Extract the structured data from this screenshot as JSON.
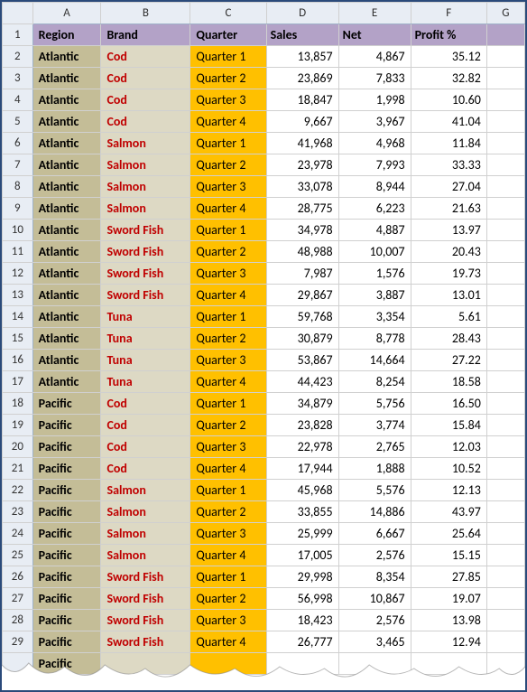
{
  "columns": [
    "A",
    "B",
    "C",
    "D",
    "E",
    "F",
    "G"
  ],
  "headers": {
    "region": "Region",
    "brand": "Brand",
    "quarter": "Quarter",
    "sales": "Sales",
    "net": "Net",
    "profit": "Profit %"
  },
  "partial_row": {
    "region": "Pacific"
  },
  "rows": [
    {
      "n": 2,
      "region": "Atlantic",
      "brand": "Cod",
      "quarter": "Quarter 1",
      "sales": "13,857",
      "net": "4,867",
      "profit": "35.12"
    },
    {
      "n": 3,
      "region": "Atlantic",
      "brand": "Cod",
      "quarter": "Quarter 2",
      "sales": "23,869",
      "net": "7,833",
      "profit": "32.82"
    },
    {
      "n": 4,
      "region": "Atlantic",
      "brand": "Cod",
      "quarter": "Quarter 3",
      "sales": "18,847",
      "net": "1,998",
      "profit": "10.60"
    },
    {
      "n": 5,
      "region": "Atlantic",
      "brand": "Cod",
      "quarter": "Quarter 4",
      "sales": "9,667",
      "net": "3,967",
      "profit": "41.04"
    },
    {
      "n": 6,
      "region": "Atlantic",
      "brand": "Salmon",
      "quarter": "Quarter 1",
      "sales": "41,968",
      "net": "4,968",
      "profit": "11.84"
    },
    {
      "n": 7,
      "region": "Atlantic",
      "brand": "Salmon",
      "quarter": "Quarter 2",
      "sales": "23,978",
      "net": "7,993",
      "profit": "33.33"
    },
    {
      "n": 8,
      "region": "Atlantic",
      "brand": "Salmon",
      "quarter": "Quarter 3",
      "sales": "33,078",
      "net": "8,944",
      "profit": "27.04"
    },
    {
      "n": 9,
      "region": "Atlantic",
      "brand": "Salmon",
      "quarter": "Quarter 4",
      "sales": "28,775",
      "net": "6,223",
      "profit": "21.63"
    },
    {
      "n": 10,
      "region": "Atlantic",
      "brand": "Sword Fish",
      "quarter": "Quarter 1",
      "sales": "34,978",
      "net": "4,887",
      "profit": "13.97"
    },
    {
      "n": 11,
      "region": "Atlantic",
      "brand": "Sword Fish",
      "quarter": "Quarter 2",
      "sales": "48,988",
      "net": "10,007",
      "profit": "20.43"
    },
    {
      "n": 12,
      "region": "Atlantic",
      "brand": "Sword Fish",
      "quarter": "Quarter 3",
      "sales": "7,987",
      "net": "1,576",
      "profit": "19.73"
    },
    {
      "n": 13,
      "region": "Atlantic",
      "brand": "Sword Fish",
      "quarter": "Quarter 4",
      "sales": "29,867",
      "net": "3,887",
      "profit": "13.01"
    },
    {
      "n": 14,
      "region": "Atlantic",
      "brand": "Tuna",
      "quarter": "Quarter 1",
      "sales": "59,768",
      "net": "3,354",
      "profit": "5.61"
    },
    {
      "n": 15,
      "region": "Atlantic",
      "brand": "Tuna",
      "quarter": "Quarter 2",
      "sales": "30,879",
      "net": "8,778",
      "profit": "28.43"
    },
    {
      "n": 16,
      "region": "Atlantic",
      "brand": "Tuna",
      "quarter": "Quarter 3",
      "sales": "53,867",
      "net": "14,664",
      "profit": "27.22"
    },
    {
      "n": 17,
      "region": "Atlantic",
      "brand": "Tuna",
      "quarter": "Quarter 4",
      "sales": "44,423",
      "net": "8,254",
      "profit": "18.58"
    },
    {
      "n": 18,
      "region": "Pacific",
      "brand": "Cod",
      "quarter": "Quarter 1",
      "sales": "34,879",
      "net": "5,756",
      "profit": "16.50"
    },
    {
      "n": 19,
      "region": "Pacific",
      "brand": "Cod",
      "quarter": "Quarter 2",
      "sales": "23,828",
      "net": "3,774",
      "profit": "15.84"
    },
    {
      "n": 20,
      "region": "Pacific",
      "brand": "Cod",
      "quarter": "Quarter 3",
      "sales": "22,978",
      "net": "2,765",
      "profit": "12.03"
    },
    {
      "n": 21,
      "region": "Pacific",
      "brand": "Cod",
      "quarter": "Quarter 4",
      "sales": "17,944",
      "net": "1,888",
      "profit": "10.52"
    },
    {
      "n": 22,
      "region": "Pacific",
      "brand": "Salmon",
      "quarter": "Quarter 1",
      "sales": "45,968",
      "net": "5,576",
      "profit": "12.13"
    },
    {
      "n": 23,
      "region": "Pacific",
      "brand": "Salmon",
      "quarter": "Quarter 2",
      "sales": "33,855",
      "net": "14,886",
      "profit": "43.97"
    },
    {
      "n": 24,
      "region": "Pacific",
      "brand": "Salmon",
      "quarter": "Quarter 3",
      "sales": "25,999",
      "net": "6,667",
      "profit": "25.64"
    },
    {
      "n": 25,
      "region": "Pacific",
      "brand": "Salmon",
      "quarter": "Quarter 4",
      "sales": "17,005",
      "net": "2,576",
      "profit": "15.15"
    },
    {
      "n": 26,
      "region": "Pacific",
      "brand": "Sword Fish",
      "quarter": "Quarter 1",
      "sales": "29,998",
      "net": "8,354",
      "profit": "27.85"
    },
    {
      "n": 27,
      "region": "Pacific",
      "brand": "Sword Fish",
      "quarter": "Quarter 2",
      "sales": "56,998",
      "net": "10,867",
      "profit": "19.07"
    },
    {
      "n": 28,
      "region": "Pacific",
      "brand": "Sword Fish",
      "quarter": "Quarter 3",
      "sales": "18,423",
      "net": "2,576",
      "profit": "13.98"
    },
    {
      "n": 29,
      "region": "Pacific",
      "brand": "Sword Fish",
      "quarter": "Quarter 4",
      "sales": "26,777",
      "net": "3,465",
      "profit": "12.94"
    }
  ],
  "chart_data": {
    "type": "table",
    "title": "Region Brand Quarter Sales Net Profit%",
    "columns": [
      "Region",
      "Brand",
      "Quarter",
      "Sales",
      "Net",
      "Profit %"
    ]
  }
}
